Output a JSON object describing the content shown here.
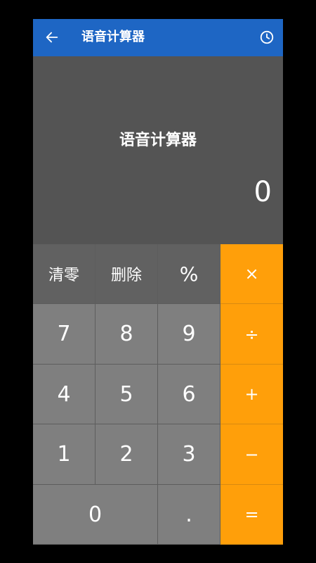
{
  "appbar": {
    "title": "语音计算器",
    "back_icon": "arrow-left-icon",
    "history_icon": "clock-history-icon",
    "color": "#1E66C4"
  },
  "display": {
    "title": "语音计算器",
    "value": "0"
  },
  "keypad": {
    "row1": [
      "清零",
      "删除",
      "%",
      "×"
    ],
    "row2": [
      "7",
      "8",
      "9",
      "÷"
    ],
    "row3": [
      "4",
      "5",
      "6",
      "+"
    ],
    "row4": [
      "1",
      "2",
      "3",
      "−"
    ],
    "row5": [
      "0",
      ".",
      "="
    ],
    "operator_color": "#FF9F0A"
  }
}
